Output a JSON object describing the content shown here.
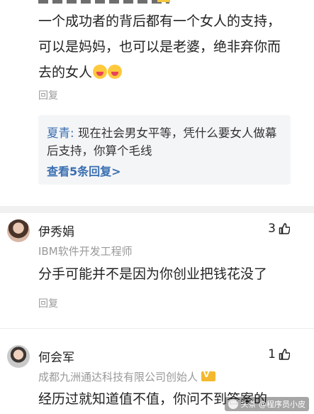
{
  "comment1": {
    "text": "一个成功者的背后都有一个女人的支持，可以是妈妈，也可以是老婆，绝非弃你而去的女人",
    "emojis": [
      "laughing-face",
      "laughing-face"
    ],
    "reply_label": "回复",
    "nested_reply": {
      "author": "夏青",
      "separator": ": ",
      "text": "现在社会男女平等，凭什么要女人做幕后支持，你算个毛线",
      "more_link": "查看5条回复>"
    }
  },
  "comment2": {
    "name": "伊秀娟",
    "title": "IBM软件开发工程师",
    "likes": "3",
    "text": "分手可能并不是因为你创业把钱花没了",
    "reply_label": "回复"
  },
  "comment3": {
    "name": "何会军",
    "title": "成都九洲通达科技有限公司创始人",
    "likes": "1",
    "text": "经历过就知道值不值，你问不到答案的"
  },
  "watermark": {
    "text": "头条 @程序员小皮"
  },
  "colors": {
    "link": "#3a6fb0",
    "muted": "#999999",
    "badge": "#f3b82e"
  }
}
